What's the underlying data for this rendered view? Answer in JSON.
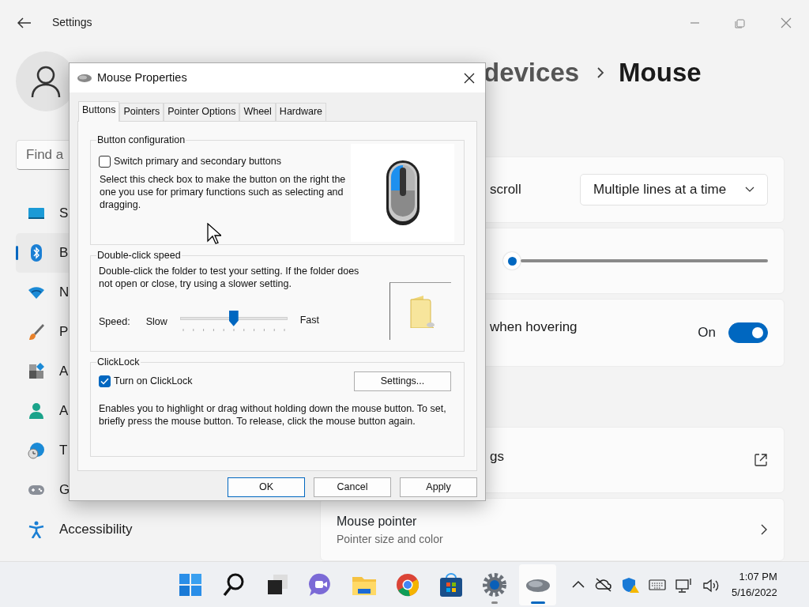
{
  "settings": {
    "title": "Settings",
    "search": {
      "placeholder": "Find a"
    },
    "nav": [
      {
        "label": "S",
        "selected": false
      },
      {
        "label": "B",
        "selected": true
      },
      {
        "label": "N",
        "selected": false
      },
      {
        "label": "P",
        "selected": false
      },
      {
        "label": "A",
        "selected": false
      },
      {
        "label": "A",
        "selected": false
      },
      {
        "label": "T",
        "selected": false
      },
      {
        "label": "G",
        "selected": false
      },
      {
        "label": "Accessibility",
        "selected": false
      }
    ],
    "breadcrumb": [
      "devices",
      "Mouse"
    ],
    "cards": [
      {
        "kind": "dropdown",
        "label": "scroll",
        "value": "Multiple lines at a time"
      },
      {
        "kind": "slider",
        "level": 0
      },
      {
        "kind": "toggle",
        "label": "when hovering",
        "state_text": "On",
        "on": true
      },
      {
        "kind": "link",
        "label": "gs"
      },
      {
        "kind": "nav",
        "label": "Mouse pointer",
        "sublabel": "Pointer size and color"
      }
    ]
  },
  "dialog": {
    "title": "Mouse Properties",
    "tabs": [
      {
        "label": "Buttons",
        "selected": true
      },
      {
        "label": "Pointers",
        "selected": false
      },
      {
        "label": "Pointer Options",
        "selected": false
      },
      {
        "label": "Wheel",
        "selected": false
      },
      {
        "label": "Hardware",
        "selected": false
      }
    ],
    "button_configuration": {
      "legend": "Button configuration",
      "checkbox": {
        "label": "Switch primary and secondary buttons",
        "checked": false
      },
      "description": "Select this check box to make the button on the right the one you use for primary functions such as selecting and dragging."
    },
    "double_click_speed": {
      "legend": "Double-click speed",
      "description": "Double-click the folder to test your setting. If the folder does not open or close, try using a slower setting.",
      "speed_label": "Speed:",
      "min_label": "Slow",
      "max_label": "Fast",
      "level": 0.5
    },
    "clicklock": {
      "legend": "ClickLock",
      "checkbox": {
        "label": "Turn on ClickLock",
        "checked": true
      },
      "settings_button": "Settings...",
      "description": "Enables you to highlight or drag without holding down the mouse button. To set, briefly press the mouse button. To release, click the mouse button again."
    },
    "buttons": [
      "OK",
      "Cancel",
      "Apply"
    ]
  },
  "taskbar": {
    "apps": [
      {
        "running": false,
        "focused": false
      },
      {
        "running": false,
        "focused": false
      },
      {
        "running": false,
        "focused": false
      },
      {
        "running": false,
        "focused": false
      },
      {
        "running": false,
        "focused": false
      },
      {
        "running": false,
        "focused": false
      },
      {
        "running": false,
        "focused": false
      },
      {
        "running": true,
        "focused": false
      },
      {
        "running": true,
        "focused": true
      }
    ],
    "time": "1:07 PM",
    "date": "5/16/2022"
  }
}
